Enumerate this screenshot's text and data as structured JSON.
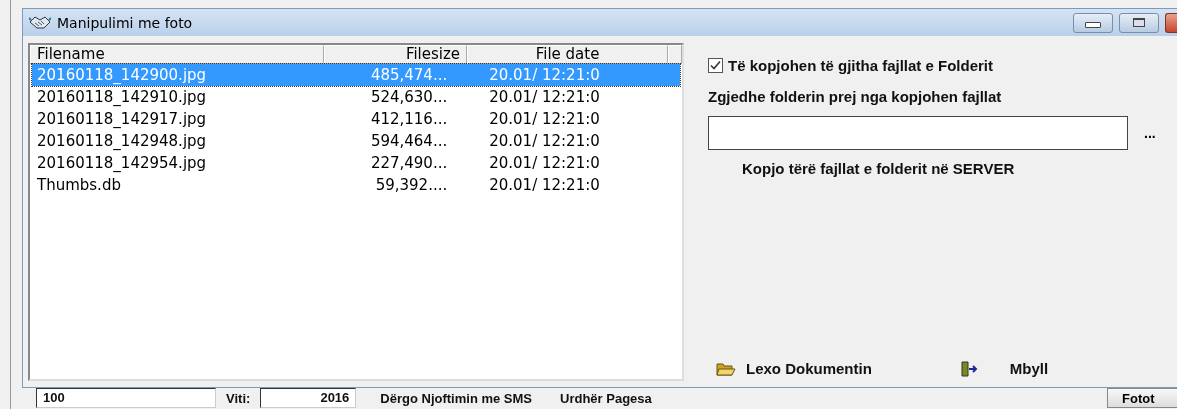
{
  "window": {
    "title": "Manipulimi me foto"
  },
  "file_list": {
    "columns": [
      "Filename",
      "Filesize",
      "File date"
    ],
    "rows": [
      {
        "filename": "20160118_142900.jpg",
        "filesize": "485,474...",
        "file_date": "20.01/ 12:21:0",
        "selected": true
      },
      {
        "filename": "20160118_142910.jpg",
        "filesize": "524,630...",
        "file_date": "20.01/ 12:21:0",
        "selected": false
      },
      {
        "filename": "20160118_142917.jpg",
        "filesize": "412,116...",
        "file_date": "20.01/ 12:21:0",
        "selected": false
      },
      {
        "filename": "20160118_142948.jpg",
        "filesize": "594,464...",
        "file_date": "20.01/ 12:21:0",
        "selected": false
      },
      {
        "filename": "20160118_142954.jpg",
        "filesize": "227,490...",
        "file_date": "20.01/ 12:21:0",
        "selected": false
      },
      {
        "filename": "Thumbs.db",
        "filesize": "59,392....",
        "file_date": "20.01/ 12:21:0",
        "selected": false
      }
    ]
  },
  "copy_all_checkbox": {
    "label": "Të kopjohen të gjitha fajllat e Folderit",
    "checked": true
  },
  "folder_label": "Zgjedhe folderin prej nga kopjohen fajllat",
  "browse_button": "...",
  "copy_button": "Kopjo tërë fajllat e folderit në SERVER",
  "read_button": "Lexo Dokumentin",
  "close_button": "Mbyll",
  "background_form": {
    "number_field": "100",
    "year_label": "Viti:",
    "year_field": "2016",
    "sms_button": "Dërgo Njoftimin me SMS",
    "payment_button": "Urdhër Pagesa",
    "photos_button": "Fotot"
  }
}
